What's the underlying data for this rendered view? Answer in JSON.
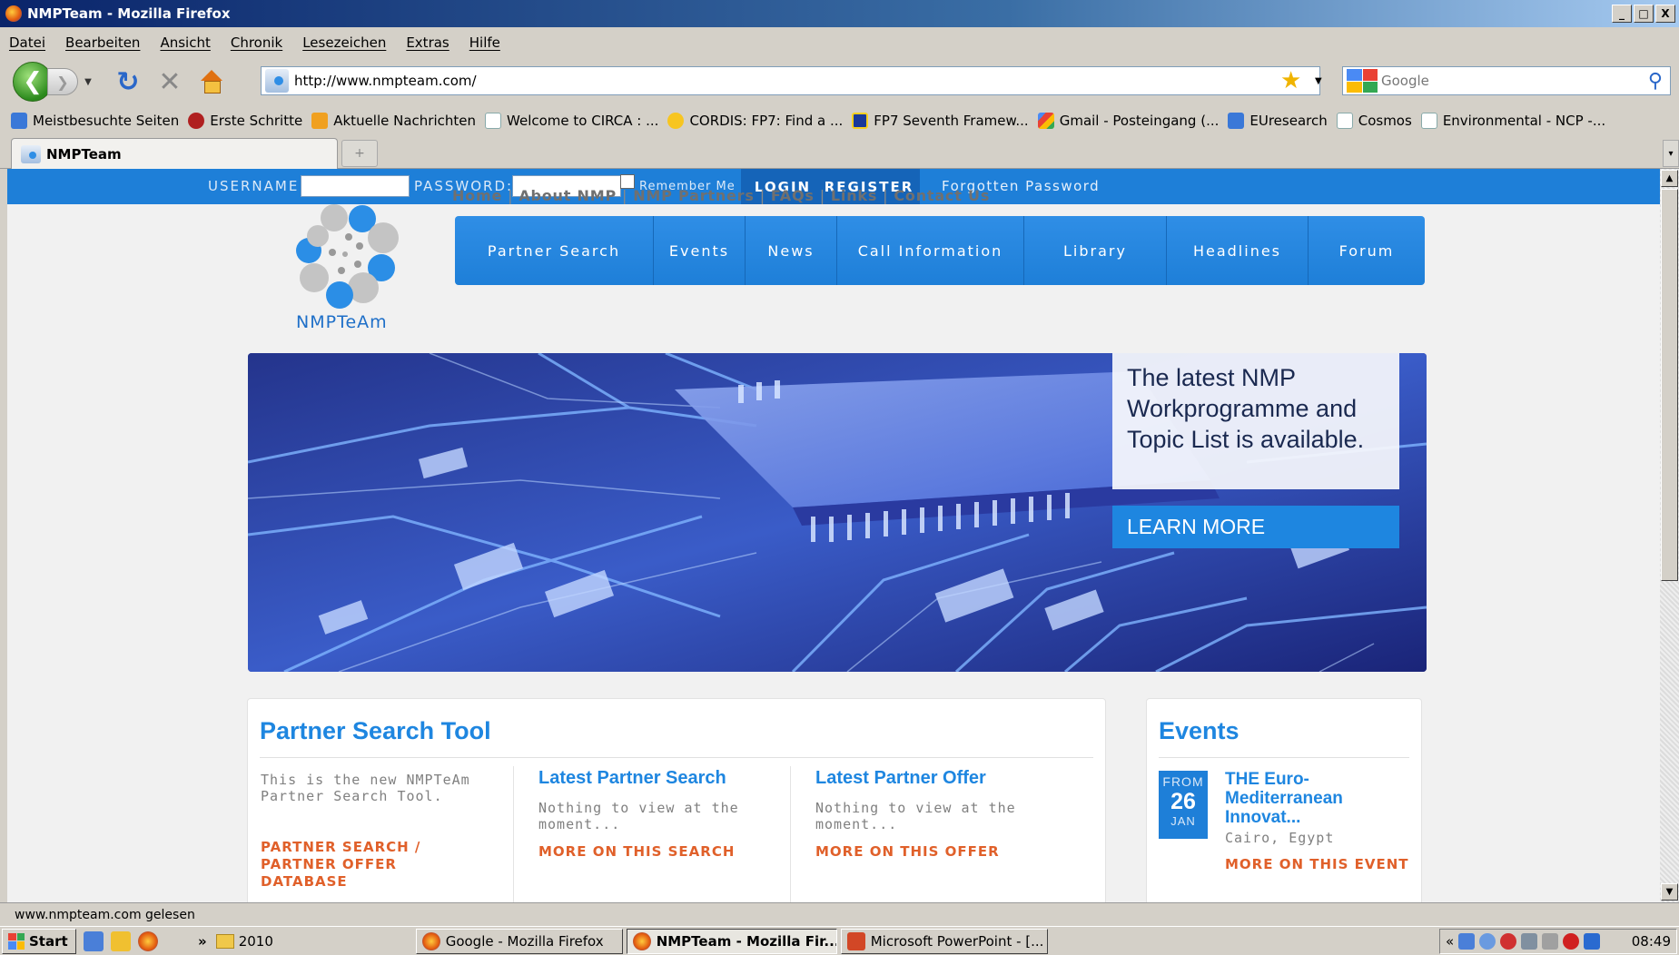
{
  "window": {
    "title": "NMPTeam - Mozilla Firefox",
    "buttons": [
      "_",
      "□",
      "X"
    ]
  },
  "menu": [
    "Datei",
    "Bearbeiten",
    "Ansicht",
    "Chronik",
    "Lesezeichen",
    "Extras",
    "Hilfe"
  ],
  "nav": {
    "url": "http://www.nmpteam.com/",
    "search_placeholder": "Google"
  },
  "bookmarks": [
    {
      "label": "Meistbesuchte Seiten",
      "icon": "blue"
    },
    {
      "label": "Erste Schritte",
      "icon": "red"
    },
    {
      "label": "Aktuelle Nachrichten",
      "icon": "orange"
    },
    {
      "label": "Welcome to CIRCA : ...",
      "icon": "page"
    },
    {
      "label": "CORDIS: FP7: Find a ...",
      "icon": "yellow"
    },
    {
      "label": "FP7 Seventh Framew...",
      "icon": "eu"
    },
    {
      "label": "Gmail - Posteingang (...",
      "icon": "gmail"
    },
    {
      "label": "EUresearch",
      "icon": "blue"
    },
    {
      "label": "Cosmos",
      "icon": "page"
    },
    {
      "label": "Environmental - NCP -...",
      "icon": "page"
    }
  ],
  "tab": {
    "label": "NMPTeam"
  },
  "site": {
    "login": {
      "username_label": "USERNAME:",
      "password_label": "PASSWORD:",
      "remember_label": "Remember Me",
      "login_button": "LOGIN",
      "register_button": "REGISTER",
      "forgot_link": "Forgotten Password"
    },
    "logo_text": "NMPTeAm",
    "top_links": [
      "Home",
      "About NMP",
      "NMP Partners",
      "FAQs",
      "Links",
      "Contact Us"
    ],
    "main_nav": [
      "Partner Search",
      "Events",
      "News",
      "Call Information",
      "Library",
      "Headlines",
      "Forum"
    ],
    "banner": {
      "text": "The latest NMP Workprogramme and Topic List is available.",
      "button": "LEARN MORE"
    },
    "partner_search": {
      "title": "Partner Search Tool",
      "intro": "This is the new NMPTeAm Partner Search Tool.",
      "intro_link": "PARTNER SEARCH / PARTNER OFFER DATABASE",
      "latest_search_title": "Latest Partner Search",
      "latest_search_text": "Nothing to view at the moment...",
      "latest_search_link": "MORE ON THIS SEARCH",
      "latest_offer_title": "Latest Partner Offer",
      "latest_offer_text": "Nothing to view at the moment...",
      "latest_offer_link": "MORE ON THIS OFFER"
    },
    "events": {
      "title": "Events",
      "from_label": "FROM",
      "day": "26",
      "month": "JAN",
      "event_title": "THE Euro-Mediterranean Innovat...",
      "location": "Cairo, Egypt",
      "link": "MORE ON THIS EVENT"
    }
  },
  "status": "www.nmpteam.com gelesen",
  "taskbar": {
    "start": "Start",
    "overflow": "»",
    "folder": "2010",
    "items": [
      {
        "label": "Google - Mozilla Firefox",
        "active": false
      },
      {
        "label": "NMPTeam - Mozilla Fir...",
        "active": true
      },
      {
        "label": "Microsoft PowerPoint - [...",
        "active": false
      }
    ],
    "tray_chevron": "«",
    "clock": "08:49"
  }
}
